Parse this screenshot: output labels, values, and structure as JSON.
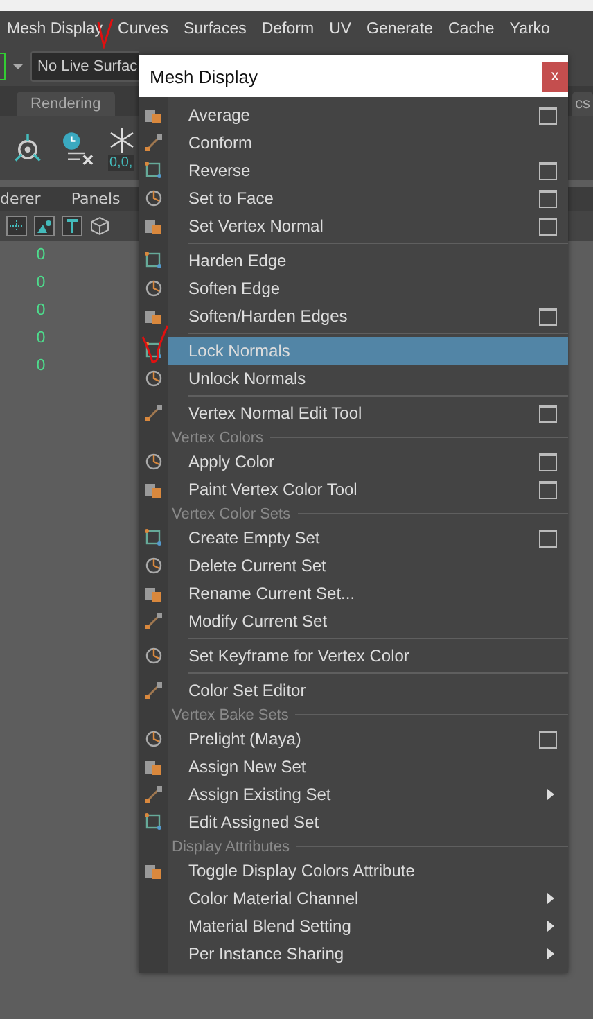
{
  "menu_bar": [
    {
      "label": "Mesh Display"
    },
    {
      "label": "Curves"
    },
    {
      "label": "Surfaces"
    },
    {
      "label": "Deform"
    },
    {
      "label": "UV"
    },
    {
      "label": "Generate"
    },
    {
      "label": "Cache"
    },
    {
      "label": "Yarko"
    }
  ],
  "surface_field": {
    "value": "No Live Surfac"
  },
  "tabs": [
    {
      "label": "Rendering"
    },
    {
      "label": "cs"
    }
  ],
  "shelf": {
    "reading": "0,0,"
  },
  "panel_menu": [
    {
      "label": "derer"
    },
    {
      "label": "Panels"
    }
  ],
  "channel_values": [
    "0",
    "0",
    "0",
    "0",
    "0"
  ],
  "dialog": {
    "title": "Mesh Display",
    "close": "x",
    "items": [
      {
        "kind": "item",
        "label": "Average",
        "icon": true,
        "option_box": true,
        "submenu": false,
        "selected": false
      },
      {
        "kind": "item",
        "label": "Conform",
        "icon": true,
        "option_box": false,
        "submenu": false,
        "selected": false
      },
      {
        "kind": "item",
        "label": "Reverse",
        "icon": true,
        "option_box": true,
        "submenu": false,
        "selected": false
      },
      {
        "kind": "item",
        "label": "Set to Face",
        "icon": true,
        "option_box": true,
        "submenu": false,
        "selected": false
      },
      {
        "kind": "item",
        "label": "Set Vertex Normal",
        "icon": true,
        "option_box": true,
        "submenu": false,
        "selected": false
      },
      {
        "kind": "separator"
      },
      {
        "kind": "item",
        "label": "Harden Edge",
        "icon": true,
        "option_box": false,
        "submenu": false,
        "selected": false
      },
      {
        "kind": "item",
        "label": "Soften Edge",
        "icon": true,
        "option_box": false,
        "submenu": false,
        "selected": false
      },
      {
        "kind": "item",
        "label": "Soften/Harden Edges",
        "icon": true,
        "option_box": true,
        "submenu": false,
        "selected": false
      },
      {
        "kind": "separator"
      },
      {
        "kind": "item",
        "label": "Lock Normals",
        "icon": true,
        "option_box": false,
        "submenu": false,
        "selected": true
      },
      {
        "kind": "item",
        "label": "Unlock Normals",
        "icon": true,
        "option_box": false,
        "submenu": false,
        "selected": false
      },
      {
        "kind": "separator"
      },
      {
        "kind": "item",
        "label": "Vertex Normal Edit Tool",
        "icon": true,
        "option_box": true,
        "submenu": false,
        "selected": false
      },
      {
        "kind": "section",
        "label": "Vertex Colors"
      },
      {
        "kind": "item",
        "label": "Apply Color",
        "icon": true,
        "option_box": true,
        "submenu": false,
        "selected": false
      },
      {
        "kind": "item",
        "label": "Paint Vertex Color Tool",
        "icon": true,
        "option_box": true,
        "submenu": false,
        "selected": false
      },
      {
        "kind": "section",
        "label": "Vertex Color Sets"
      },
      {
        "kind": "item",
        "label": "Create Empty Set",
        "icon": true,
        "option_box": true,
        "submenu": false,
        "selected": false
      },
      {
        "kind": "item",
        "label": "Delete Current Set",
        "icon": true,
        "option_box": false,
        "submenu": false,
        "selected": false
      },
      {
        "kind": "item",
        "label": "Rename Current Set...",
        "icon": true,
        "option_box": false,
        "submenu": false,
        "selected": false
      },
      {
        "kind": "item",
        "label": "Modify Current Set",
        "icon": true,
        "option_box": false,
        "submenu": false,
        "selected": false
      },
      {
        "kind": "separator"
      },
      {
        "kind": "item",
        "label": "Set Keyframe for Vertex Color",
        "icon": true,
        "option_box": false,
        "submenu": false,
        "selected": false
      },
      {
        "kind": "separator"
      },
      {
        "kind": "item",
        "label": "Color Set Editor",
        "icon": true,
        "option_box": false,
        "submenu": false,
        "selected": false
      },
      {
        "kind": "section",
        "label": "Vertex Bake Sets"
      },
      {
        "kind": "item",
        "label": "Prelight (Maya)",
        "icon": true,
        "option_box": true,
        "submenu": false,
        "selected": false
      },
      {
        "kind": "item",
        "label": "Assign New Set",
        "icon": true,
        "option_box": false,
        "submenu": false,
        "selected": false
      },
      {
        "kind": "item",
        "label": "Assign Existing Set",
        "icon": true,
        "option_box": false,
        "submenu": true,
        "selected": false
      },
      {
        "kind": "item",
        "label": "Edit Assigned Set",
        "icon": true,
        "option_box": false,
        "submenu": false,
        "selected": false
      },
      {
        "kind": "section",
        "label": "Display Attributes"
      },
      {
        "kind": "item",
        "label": "Toggle Display Colors Attribute",
        "icon": true,
        "option_box": false,
        "submenu": false,
        "selected": false
      },
      {
        "kind": "item",
        "label": "Color Material Channel",
        "icon": false,
        "option_box": false,
        "submenu": true,
        "selected": false
      },
      {
        "kind": "item",
        "label": "Material Blend Setting",
        "icon": false,
        "option_box": false,
        "submenu": true,
        "selected": false
      },
      {
        "kind": "item",
        "label": "Per Instance Sharing",
        "icon": false,
        "option_box": false,
        "submenu": true,
        "selected": false
      }
    ]
  }
}
